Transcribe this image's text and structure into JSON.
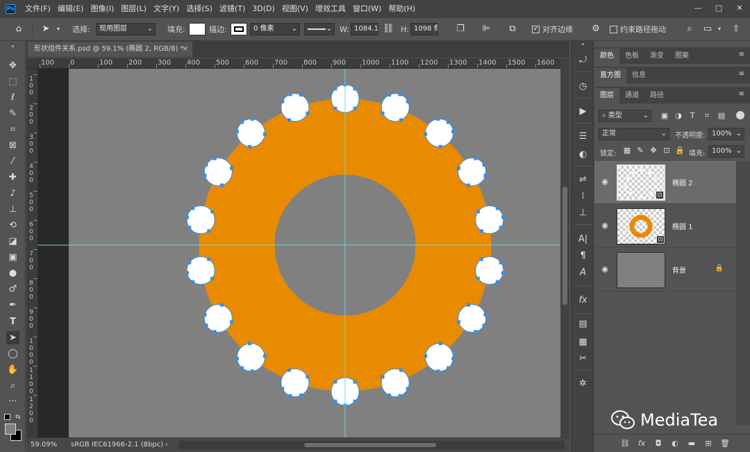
{
  "app": {
    "logo": "Ps",
    "menus": [
      "文件(F)",
      "编辑(E)",
      "图像(I)",
      "图层(L)",
      "文字(Y)",
      "选择(S)",
      "滤镜(T)",
      "3D(D)",
      "视图(V)",
      "增效工具",
      "窗口(W)",
      "帮助(H)"
    ],
    "window_controls": [
      "—",
      "□",
      "✕"
    ]
  },
  "options_bar": {
    "select_label": "选择:",
    "select_value": "现用图层",
    "fill_label": "填充:",
    "stroke_label": "描边:",
    "stroke_width": "0 像素",
    "width_label": "W:",
    "width_value": "1084.16",
    "height_label": "H:",
    "height_value": "1098 像",
    "align_edges_label": "对齐边缘",
    "align_edges_checked": true,
    "constrain_path_label": "约束路径拖动",
    "constrain_path_checked": false
  },
  "document": {
    "tab_title": "形状组件关系.psd @ 59.1% (椭圆 2, RGB/8) *",
    "tab_close": "×",
    "ruler_top_labels": [
      "100",
      "0",
      "100",
      "200",
      "300",
      "400",
      "500",
      "600",
      "700",
      "800",
      "900",
      "1000",
      "1100",
      "1200",
      "1300",
      "1400",
      "1500",
      "1600"
    ],
    "ruler_left_labels": [
      "100",
      "200",
      "300",
      "400",
      "500",
      "600",
      "700",
      "800",
      "900",
      "1000",
      "1100",
      "1200"
    ],
    "zoom": "59.09%",
    "color_profile": "sRGB IEC61966-2.1 (8bpc)"
  },
  "colors": {
    "ring": "#e88b00",
    "circle_fill": "#ffffff",
    "path_stroke": "#3b8fdd",
    "guide": "#5fd8ea",
    "canvas": "#808080"
  },
  "panels": {
    "top_tabs": [
      "颜色",
      "色板",
      "渐变",
      "图案"
    ],
    "mid_tabs": [
      "直方图",
      "信息"
    ],
    "layer_tabs": [
      "图层",
      "通道",
      "路径"
    ],
    "filter_kind": "类型",
    "blend_mode": "正常",
    "opacity_label": "不透明度:",
    "opacity_value": "100%",
    "lock_label": "锁定:",
    "fill_label": "填充:",
    "fill_value": "100%",
    "layers": [
      {
        "name": "椭圆 2",
        "selected": true
      },
      {
        "name": "椭圆 1",
        "selected": false
      },
      {
        "name": "背景",
        "selected": false
      }
    ]
  },
  "watermark": {
    "text": "MediaTea"
  },
  "icons": {
    "left_tools": [
      "move-icon",
      "marquee-icon",
      "lasso-icon",
      "quick-select-icon",
      "crop-icon",
      "frame-icon",
      "eyedropper-icon",
      "healing-icon",
      "brush-icon",
      "stamp-icon",
      "history-brush-icon",
      "eraser-icon",
      "gradient-icon",
      "blur-icon",
      "dodge-icon",
      "pen-icon",
      "type-icon",
      "path-select-icon",
      "ellipse-icon",
      "hand-icon",
      "zoom-icon",
      "more-icon"
    ]
  }
}
